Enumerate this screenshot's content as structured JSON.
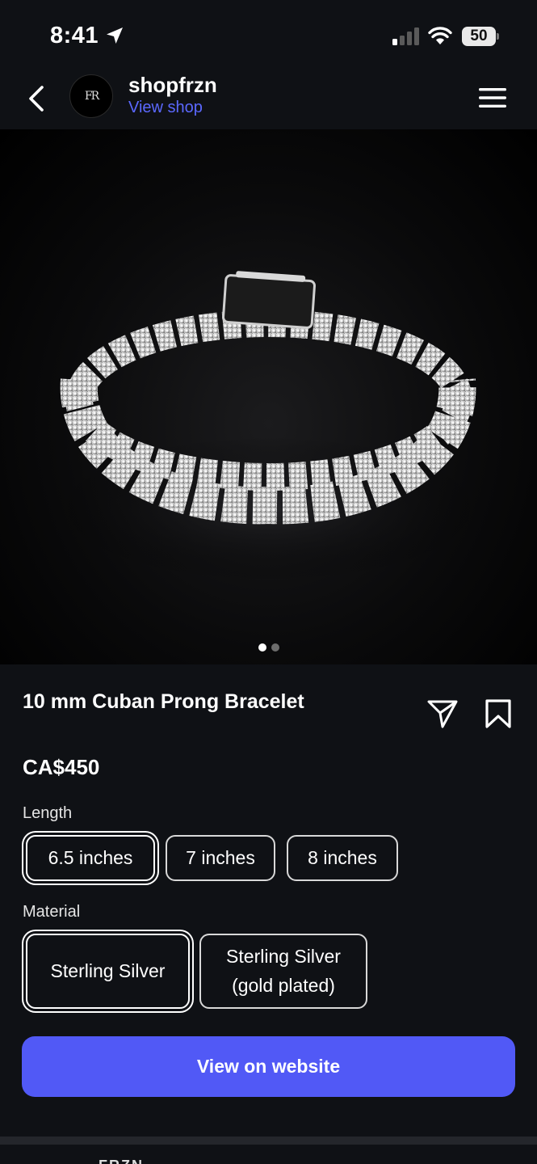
{
  "status_bar": {
    "time": "8:41",
    "battery": "50",
    "icons": [
      "location-arrow-icon",
      "cellular-signal-icon",
      "wifi-icon",
      "battery-icon"
    ]
  },
  "header": {
    "shop_name": "shopfrzn",
    "view_shop_label": "View shop",
    "avatar_logo": "FR",
    "icons": [
      "back-chevron-icon",
      "hamburger-menu-icon"
    ]
  },
  "product": {
    "image_alt": "bracelet",
    "carousel": {
      "total": 2,
      "active_index": 0
    },
    "title": "10 mm Cuban Prong Bracelet",
    "price": "CA$450",
    "actions": [
      "share-icon",
      "bookmark-icon"
    ]
  },
  "options": {
    "length": {
      "label": "Length",
      "values": [
        "6.5 inches",
        "7 inches",
        "8 inches"
      ],
      "selected": "6.5 inches"
    },
    "material": {
      "label": "Material",
      "values": [
        "Sterling Silver",
        "Sterling Silver\n(gold plated)"
      ],
      "selected": "Sterling Silver"
    }
  },
  "cta": {
    "label": "View on website"
  },
  "colors": {
    "accent": "#5159f6",
    "link": "#5b68ff",
    "background": "#0f1115"
  },
  "next_card": {
    "text": "FRZN"
  }
}
